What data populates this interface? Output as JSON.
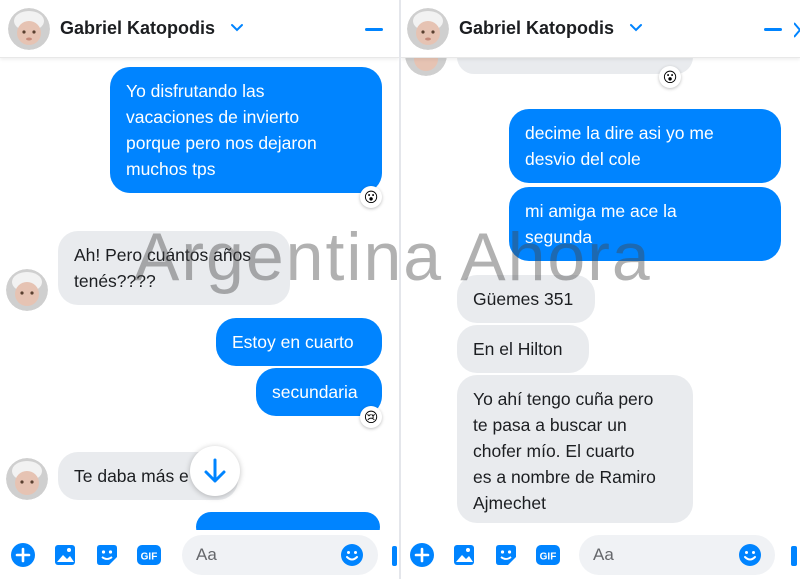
{
  "watermark": "Argentina Ahora",
  "colors": {
    "accent": "#0084ff",
    "outgoing_bubble": "#0084ff",
    "incoming_bubble": "#e9ebee",
    "text": "#1c1e21"
  },
  "left_panel": {
    "contact_name": "Gabriel Katopodis",
    "messages": [
      {
        "direction": "outgoing",
        "lines": [
          "Yo disfrutando las",
          "vacaciones de invierto",
          "porque pero nos dejaron",
          "muchos tps"
        ],
        "reaction": "wow-emoji"
      },
      {
        "direction": "incoming",
        "lines": [
          "Ah! Pero cuántos años",
          "tenés????"
        ]
      },
      {
        "direction": "outgoing",
        "lines": [
          "Estoy en cuarto"
        ]
      },
      {
        "direction": "outgoing",
        "lines": [
          "secundaria"
        ],
        "reaction": "sad-emoji"
      },
      {
        "direction": "incoming",
        "lines": [
          "Te daba más e"
        ]
      }
    ],
    "composer_placeholder": "Aa"
  },
  "right_panel": {
    "contact_name": "Gabriel Katopodis",
    "messages": [
      {
        "direction": "outgoing",
        "lines": [
          "decime la dire asi yo me",
          "desvio del cole"
        ]
      },
      {
        "direction": "outgoing",
        "lines": [
          "mi amiga me ace la",
          "segunda"
        ]
      },
      {
        "direction": "incoming",
        "lines": [
          "Güemes 351"
        ]
      },
      {
        "direction": "incoming",
        "lines": [
          "En el Hilton"
        ]
      },
      {
        "direction": "incoming",
        "lines": [
          "Yo ahí tengo cuña pero",
          "te pasa a buscar un",
          "chofer mío. El cuarto",
          "es a nombre de Ramiro",
          "Ajmechet"
        ]
      }
    ],
    "composer_placeholder": "Aa"
  },
  "composer_icons": [
    "add-icon",
    "photo-icon",
    "sticker-icon",
    "gif-icon",
    "emoji-icon"
  ],
  "gif_label": "GIF"
}
